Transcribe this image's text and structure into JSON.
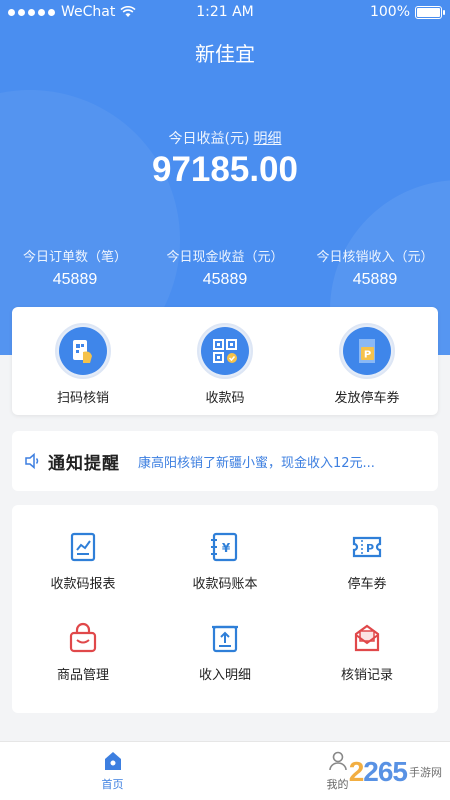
{
  "status_bar": {
    "carrier": "WeChat",
    "time": "1:21 AM",
    "battery": "100%"
  },
  "app": {
    "title": "新佳宜"
  },
  "earnings": {
    "label": "今日收益(元)",
    "detail_link": "明细",
    "amount": "97185.00"
  },
  "stats": [
    {
      "label": "今日订单数（笔）",
      "value": "45889"
    },
    {
      "label": "今日现金收益（元）",
      "value": "45889"
    },
    {
      "label": "今日核销收入（元）",
      "value": "45889"
    }
  ],
  "quick_actions": [
    {
      "label": "扫码核销",
      "icon": "scan-verify-icon"
    },
    {
      "label": "收款码",
      "icon": "qr-code-icon"
    },
    {
      "label": "发放停车券",
      "icon": "parking-ticket-icon"
    }
  ],
  "notice": {
    "title": "通知提醒",
    "message": "康高阳核销了新疆小蜜，现金收入12元..."
  },
  "grid_menu": [
    {
      "label": "收款码报表",
      "icon": "report-icon"
    },
    {
      "label": "收款码账本",
      "icon": "ledger-icon"
    },
    {
      "label": "停车券",
      "icon": "parking-coupon-icon"
    },
    {
      "label": "商品管理",
      "icon": "shopping-bag-icon"
    },
    {
      "label": "收入明细",
      "icon": "income-detail-icon"
    },
    {
      "label": "核销记录",
      "icon": "verify-record-icon"
    }
  ],
  "tabbar": [
    {
      "label": "首页",
      "icon": "home-icon",
      "active": true
    },
    {
      "label": "我的",
      "icon": "profile-icon",
      "active": false
    }
  ],
  "watermark": {
    "number_a": "2",
    "number_b": "265",
    "text": "手游网"
  },
  "colors": {
    "primary": "#4a8ef0",
    "accent_red": "#e0484a",
    "accent_blue": "#2f7fd8"
  }
}
